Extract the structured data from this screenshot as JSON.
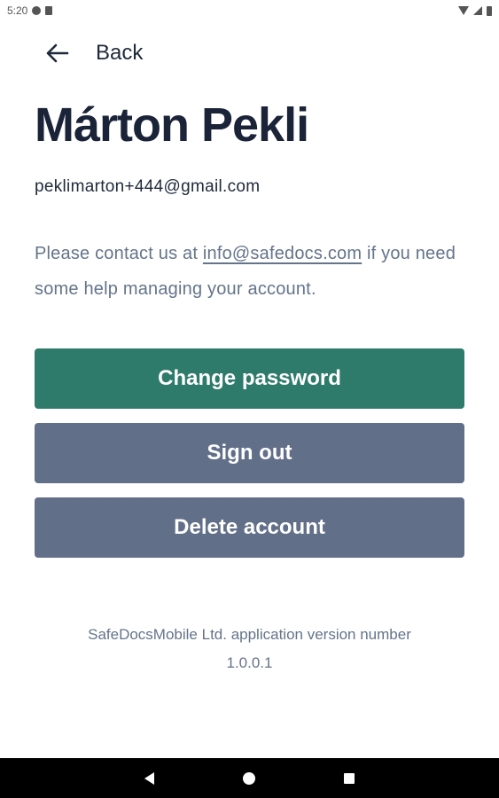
{
  "status_bar": {
    "time": "5:20",
    "icons": [
      "sync-icon",
      "sd-card-icon",
      "wifi-icon",
      "signal-icon",
      "battery-icon"
    ]
  },
  "header": {
    "back_label": "Back",
    "back_icon": "arrow-left-icon"
  },
  "profile": {
    "name": "Márton Pekli",
    "email": "peklimarton+444@gmail.com"
  },
  "help": {
    "text_before": "Please contact us at ",
    "link": "info@safedocs.com",
    "text_after": " if you need some help managing your account."
  },
  "actions": {
    "change_password": "Change password",
    "sign_out": "Sign out",
    "delete_account": "Delete account"
  },
  "footer": {
    "version_text": "SafeDocsMobile Ltd. application version number",
    "version_number": "1.0.0.1"
  },
  "nav": {
    "icons": [
      "nav-back-icon",
      "nav-home-icon",
      "nav-recents-icon"
    ]
  },
  "colors": {
    "primary": "#2e7b6b",
    "secondary": "#626f89",
    "heading": "#1a2338",
    "muted": "#64748b"
  }
}
